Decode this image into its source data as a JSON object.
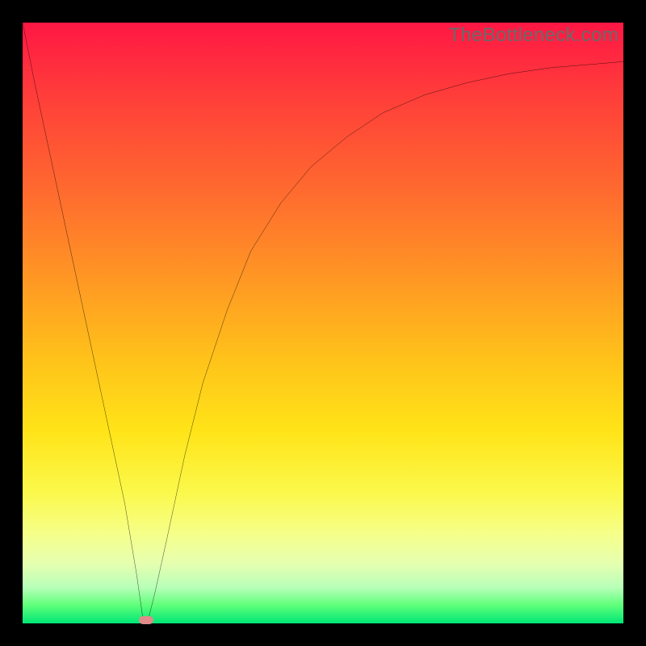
{
  "watermark": "TheBottleneck.com",
  "chart_data": {
    "type": "line",
    "title": "",
    "xlabel": "",
    "ylabel": "",
    "xlim": [
      0,
      100
    ],
    "ylim": [
      0,
      100
    ],
    "grid": false,
    "legend": false,
    "background_gradient": {
      "orientation": "vertical",
      "stops": [
        {
          "pos": 0.0,
          "color": "#ff1744"
        },
        {
          "pos": 0.28,
          "color": "#ff6a2f"
        },
        {
          "pos": 0.56,
          "color": "#ffc21a"
        },
        {
          "pos": 0.78,
          "color": "#fbf84a"
        },
        {
          "pos": 0.94,
          "color": "#b8ffb8"
        },
        {
          "pos": 1.0,
          "color": "#00e676"
        }
      ]
    },
    "x": [
      0,
      2,
      5,
      8,
      11,
      14,
      17,
      19,
      20,
      21,
      22,
      24,
      27,
      30,
      34,
      38,
      43,
      48,
      54,
      60,
      67,
      74,
      81,
      88,
      94,
      100
    ],
    "values": [
      100,
      90,
      76,
      62,
      48,
      34,
      20,
      8,
      1,
      1,
      5,
      14,
      28,
      40,
      52,
      62,
      70,
      76,
      81,
      85,
      88,
      90,
      91.5,
      92.5,
      93,
      93.5
    ],
    "marker": {
      "x": 20.5,
      "y": 0.5,
      "color": "#e08a8a"
    }
  }
}
